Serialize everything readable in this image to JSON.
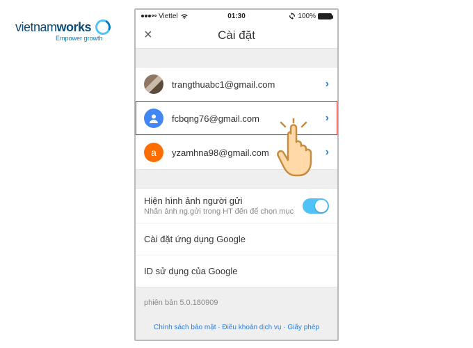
{
  "brand": {
    "name_prefix": "vietnam",
    "name_suffix": "works",
    "tagline": "Empower growth"
  },
  "statusbar": {
    "carrier": "Viettel",
    "time": "01:30",
    "battery_pct": "100%"
  },
  "nav": {
    "title": "Cài đặt",
    "close_icon": "×"
  },
  "accounts": [
    {
      "email": "trangthuabc1@gmail.com",
      "avatar_type": "photo",
      "avatar_letter": ""
    },
    {
      "email": "fcbqng76@gmail.com",
      "avatar_type": "blue",
      "avatar_letter": ""
    },
    {
      "email": "yzamhna98@gmail.com",
      "avatar_type": "orange",
      "avatar_letter": "a"
    }
  ],
  "settings": {
    "sender_images_title": "Hiện hình ảnh người gửi",
    "sender_images_sub": "Nhấn ảnh ng.gửi trong HT đến để chọn mục",
    "sender_images_toggle": true,
    "google_app_settings": "Cài đặt ứng dụng Google",
    "google_id": "ID sử dụng của Google"
  },
  "version": "phiên bản 5.0.180909",
  "footer": {
    "privacy": "Chính sách bảo mật",
    "terms": "Điều khoản dịch vụ",
    "license": "Giấy phép",
    "sep": " · "
  }
}
